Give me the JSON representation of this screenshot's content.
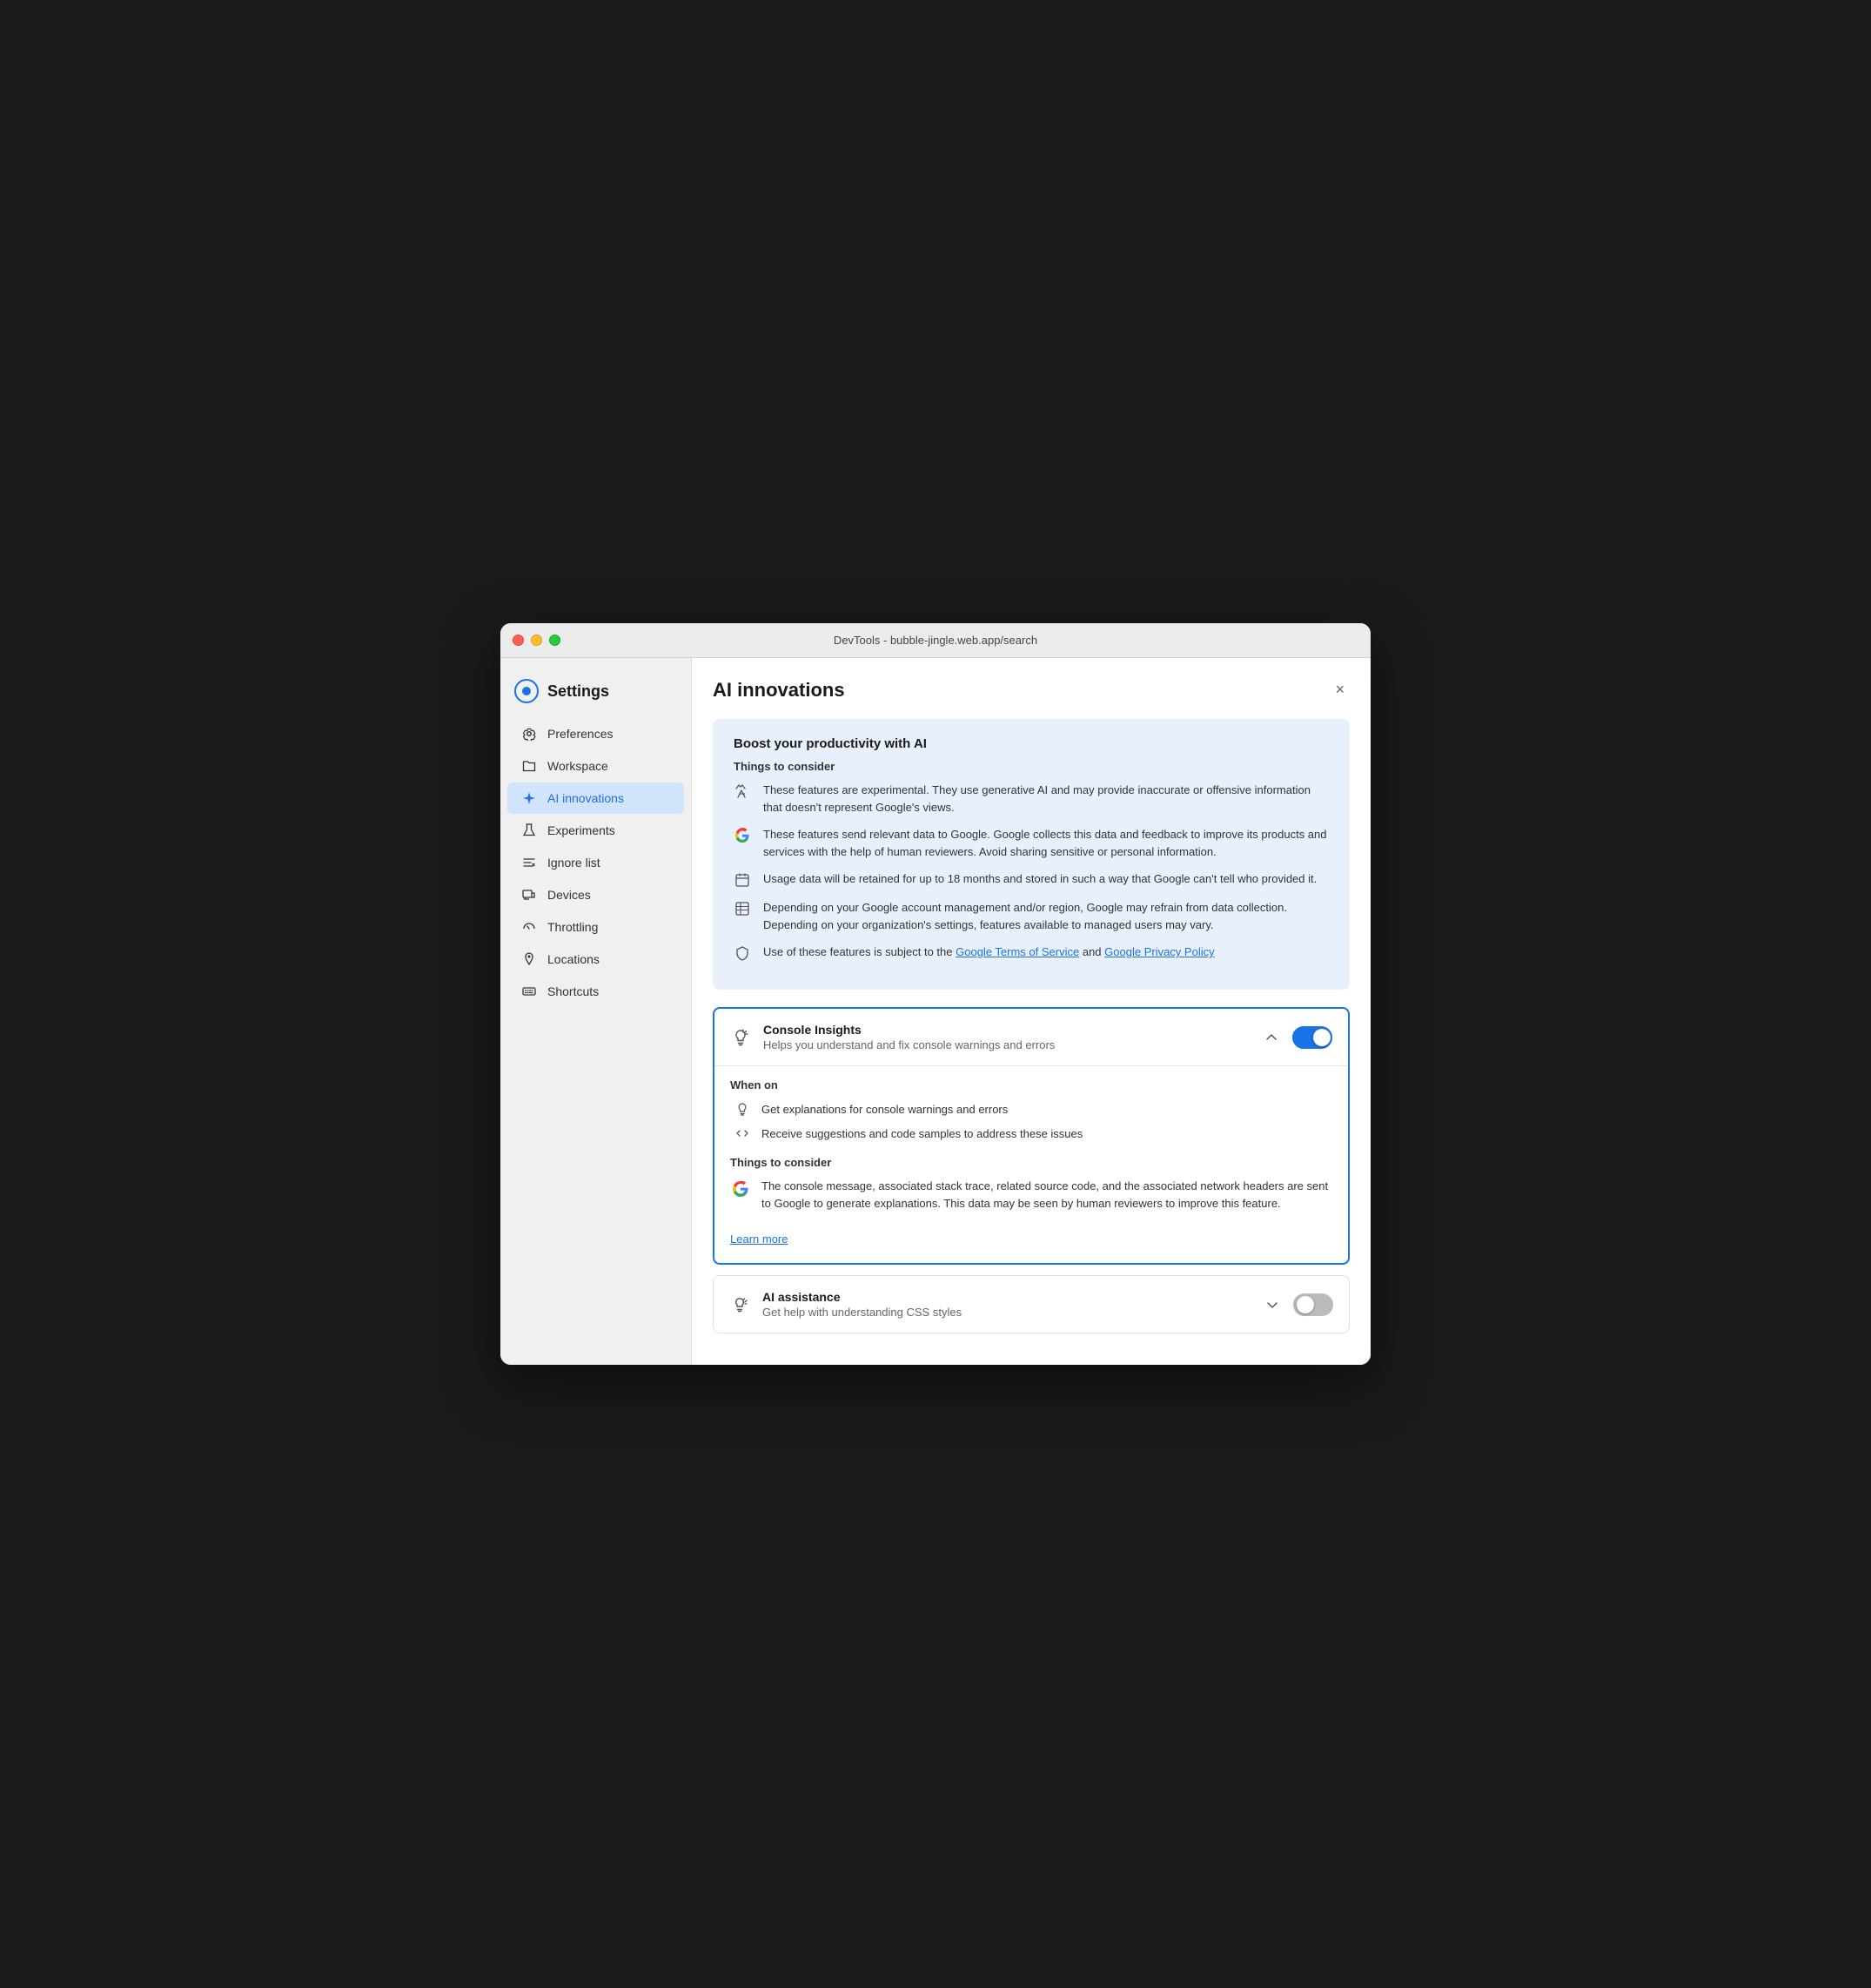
{
  "titlebar": {
    "title": "DevTools - bubble-jingle.web.app/search"
  },
  "sidebar": {
    "header": {
      "title": "Settings"
    },
    "items": [
      {
        "id": "preferences",
        "label": "Preferences",
        "icon": "gear"
      },
      {
        "id": "workspace",
        "label": "Workspace",
        "icon": "folder"
      },
      {
        "id": "ai-innovations",
        "label": "AI innovations",
        "icon": "sparkle",
        "active": true
      },
      {
        "id": "experiments",
        "label": "Experiments",
        "icon": "flask"
      },
      {
        "id": "ignore-list",
        "label": "Ignore list",
        "icon": "list-x"
      },
      {
        "id": "devices",
        "label": "Devices",
        "icon": "devices"
      },
      {
        "id": "throttling",
        "label": "Throttling",
        "icon": "gauge"
      },
      {
        "id": "locations",
        "label": "Locations",
        "icon": "pin"
      },
      {
        "id": "shortcuts",
        "label": "Shortcuts",
        "icon": "keyboard"
      }
    ]
  },
  "main": {
    "title": "AI innovations",
    "close_label": "×",
    "info_card": {
      "title": "Boost your productivity with AI",
      "subtitle": "Things to consider",
      "items": [
        {
          "icon": "experimental",
          "text": "These features are experimental. They use generative AI and may provide inaccurate or offensive information that doesn't represent Google's views."
        },
        {
          "icon": "google",
          "text": "These features send relevant data to Google. Google collects this data and feedback to improve its products and services with the help of human reviewers. Avoid sharing sensitive or personal information."
        },
        {
          "icon": "calendar",
          "text": "Usage data will be retained for up to 18 months and stored in such a way that Google can't tell who provided it."
        },
        {
          "icon": "table",
          "text": "Depending on your Google account management and/or region, Google may refrain from data collection. Depending on your organization's settings, features available to managed users may vary."
        },
        {
          "icon": "shield",
          "text_before": "Use of these features is subject to the ",
          "link1_text": "Google Terms of Service",
          "link1_url": "#",
          "text_middle": " and ",
          "link2_text": "Google Privacy Policy",
          "link2_url": "#",
          "text_after": "",
          "has_links": true
        }
      ]
    },
    "features": [
      {
        "id": "console-insights",
        "icon": "lightbulb-plus",
        "name": "Console Insights",
        "description": "Helps you understand and fix console warnings and errors",
        "expanded": true,
        "toggle_on": true,
        "when_on_title": "When on",
        "when_on_items": [
          {
            "icon": "lightbulb",
            "text": "Get explanations for console warnings and errors"
          },
          {
            "icon": "code",
            "text": "Receive suggestions and code samples to address these issues"
          }
        ],
        "things_title": "Things to consider",
        "things_items": [
          {
            "icon": "google",
            "text": "The console message, associated stack trace, related source code, and the associated network headers are sent to Google to generate explanations. This data may be seen by human reviewers to improve this feature."
          }
        ],
        "learn_more_text": "Learn more",
        "learn_more_url": "#"
      },
      {
        "id": "ai-assistance",
        "icon": "ai-assist",
        "name": "AI assistance",
        "description": "Get help with understanding CSS styles",
        "expanded": false,
        "toggle_on": false
      }
    ]
  }
}
